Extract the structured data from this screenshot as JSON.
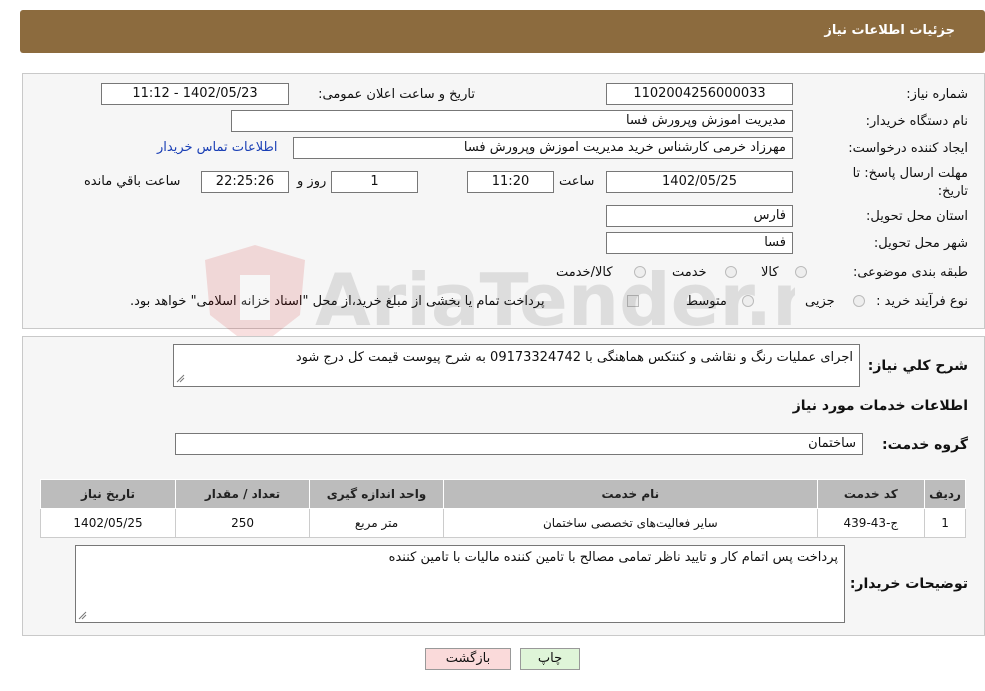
{
  "header": {
    "title": "جزئیات اطلاعات نیاز"
  },
  "form": {
    "need_number": {
      "label": "شماره نیاز:",
      "value": "1102004256000033"
    },
    "announce_datetime": {
      "label": "تاریخ و ساعت اعلان عمومی:",
      "value": "1402/05/23 - 11:12"
    },
    "buyer_org": {
      "label": "نام دستگاه خریدار:",
      "value": "مدیریت اموزش وپرورش فسا"
    },
    "requester": {
      "label": "ایجاد کننده درخواست:",
      "value": "مهرزاد خرمی کارشناس خرید مدیریت اموزش وپرورش فسا",
      "contact_link": "اطلاعات تماس خریدار"
    },
    "deadline": {
      "label_line1": "مهلت ارسال پاسخ: تا",
      "label_line2": "تاریخ:",
      "date": "1402/05/25",
      "time_label": "ساعت",
      "time": "11:20",
      "days": "1",
      "days_label": "روز و",
      "remaining": "22:25:26",
      "remaining_label": "ساعت باقي مانده"
    },
    "province": {
      "label": "استان محل تحویل:",
      "value": "فارس"
    },
    "city": {
      "label": "شهر محل تحویل:",
      "value": "فسا"
    },
    "category": {
      "label": "طبقه بندی موضوعی:",
      "options": [
        "کالا",
        "خدمت",
        "کالا/خدمت"
      ]
    },
    "purchase_process": {
      "label": "نوع فرآیند خرید :",
      "options": [
        "جزیی",
        "متوسط"
      ],
      "note": "پرداخت تمام یا بخشی از مبلغ خرید،از محل \"اسناد خزانه اسلامی\" خواهد بود."
    }
  },
  "details": {
    "description_label": "شرح کلي نياز:",
    "description": "اجرای عملیات رنگ و نقاشی و کنتکس هماهنگی با 09173324742 به شرح پیوست قیمت کل درج شود",
    "services_title": "اطلاعات خدمات مورد نياز",
    "service_group_label": "گروه خدمت:",
    "service_group": "ساختمان",
    "table": {
      "headers": [
        "ردیف",
        "کد خدمت",
        "نام خدمت",
        "واحد اندازه گیری",
        "تعداد / مقدار",
        "تاریخ نیاز"
      ],
      "rows": [
        [
          "1",
          "ج-43-439",
          "سایر فعالیت‌های تخصصی ساختمان",
          "متر مربع",
          "250",
          "1402/05/25"
        ]
      ]
    },
    "buyer_notes_label": "توضیحات خریدار:",
    "buyer_notes": "پرداخت پس اتمام کار و تایید ناظر تمامی مصالح با تامین کننده مالیات با تامین کننده"
  },
  "buttons": {
    "print": "چاپ",
    "back": "بازگشت"
  },
  "watermark": "AriaTender.neT"
}
